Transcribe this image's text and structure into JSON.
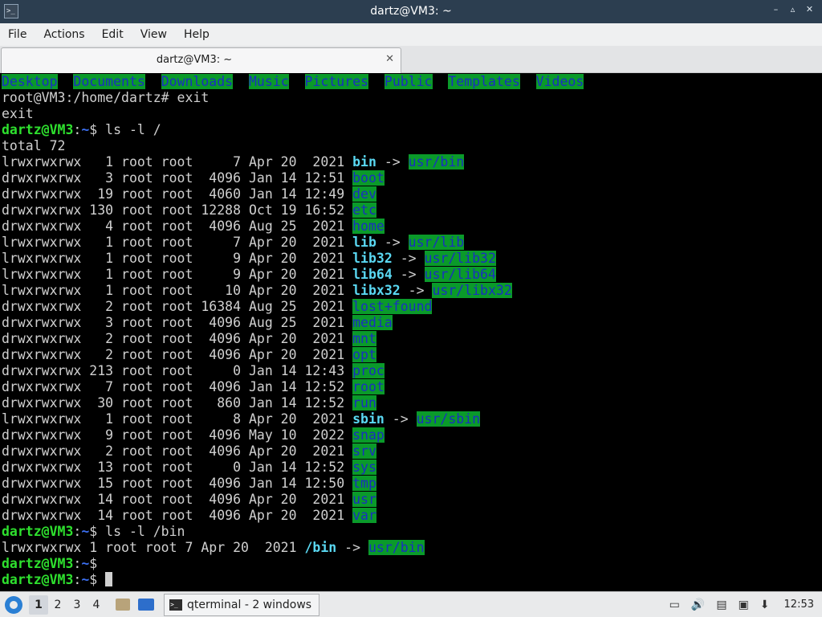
{
  "window": {
    "title": "dartz@VM3: ~",
    "controls": [
      "–",
      "▵",
      "✕"
    ]
  },
  "menubar": [
    "File",
    "Actions",
    "Edit",
    "View",
    "Help"
  ],
  "tab": {
    "label": "dartz@VM3: ~"
  },
  "terminal": {
    "home_dirs": [
      "Desktop",
      "Documents",
      "Downloads",
      "Music",
      "Pictures",
      "Public",
      "Templates",
      "Videos"
    ],
    "root_prompt": "root@VM3:/home/dartz#",
    "root_cmd": " exit",
    "exit_out": "exit",
    "prompt_user": "dartz@VM3",
    "prompt_path": "~",
    "cmd1": "$ ls -l /",
    "total": "total 72",
    "entries": [
      {
        "meta": "lrwxrwxrwx   1 root root     7 Apr 20  2021 ",
        "name": "bin",
        "link": true,
        "target": "usr/bin"
      },
      {
        "meta": "drwxrwxrwx   3 root root  4096 Jan 14 12:51 ",
        "name": "boot",
        "link": false
      },
      {
        "meta": "drwxrwxrwx  19 root root  4060 Jan 14 12:49 ",
        "name": "dev",
        "link": false
      },
      {
        "meta": "drwxrwxrwx 130 root root 12288 Oct 19 16:52 ",
        "name": "etc",
        "link": false
      },
      {
        "meta": "drwxrwxrwx   4 root root  4096 Aug 25  2021 ",
        "name": "home",
        "link": false
      },
      {
        "meta": "lrwxrwxrwx   1 root root     7 Apr 20  2021 ",
        "name": "lib",
        "link": true,
        "target": "usr/lib"
      },
      {
        "meta": "lrwxrwxrwx   1 root root     9 Apr 20  2021 ",
        "name": "lib32",
        "link": true,
        "target": "usr/lib32"
      },
      {
        "meta": "lrwxrwxrwx   1 root root     9 Apr 20  2021 ",
        "name": "lib64",
        "link": true,
        "target": "usr/lib64"
      },
      {
        "meta": "lrwxrwxrwx   1 root root    10 Apr 20  2021 ",
        "name": "libx32",
        "link": true,
        "target": "usr/libx32"
      },
      {
        "meta": "drwxrwxrwx   2 root root 16384 Aug 25  2021 ",
        "name": "lost+found",
        "link": false
      },
      {
        "meta": "drwxrwxrwx   3 root root  4096 Aug 25  2021 ",
        "name": "media",
        "link": false
      },
      {
        "meta": "drwxrwxrwx   2 root root  4096 Apr 20  2021 ",
        "name": "mnt",
        "link": false
      },
      {
        "meta": "drwxrwxrwx   2 root root  4096 Apr 20  2021 ",
        "name": "opt",
        "link": false
      },
      {
        "meta": "drwxrwxrwx 213 root root     0 Jan 14 12:43 ",
        "name": "proc",
        "link": false
      },
      {
        "meta": "drwxrwxrwx   7 root root  4096 Jan 14 12:52 ",
        "name": "root",
        "link": false
      },
      {
        "meta": "drwxrwxrwx  30 root root   860 Jan 14 12:52 ",
        "name": "run",
        "link": false
      },
      {
        "meta": "lrwxrwxrwx   1 root root     8 Apr 20  2021 ",
        "name": "sbin",
        "link": true,
        "target": "usr/sbin"
      },
      {
        "meta": "drwxrwxrwx   9 root root  4096 May 10  2022 ",
        "name": "snap",
        "link": false
      },
      {
        "meta": "drwxrwxrwx   2 root root  4096 Apr 20  2021 ",
        "name": "srv",
        "link": false
      },
      {
        "meta": "drwxrwxrwx  13 root root     0 Jan 14 12:52 ",
        "name": "sys",
        "link": false
      },
      {
        "meta": "drwxrwxrwx  15 root root  4096 Jan 14 12:50 ",
        "name": "tmp",
        "link": false
      },
      {
        "meta": "drwxrwxrwx  14 root root  4096 Apr 20  2021 ",
        "name": "usr",
        "link": false
      },
      {
        "meta": "drwxrwxrwx  14 root root  4096 Apr 20  2021 ",
        "name": "var",
        "link": false
      }
    ],
    "arrow": " -> ",
    "cmd2": "$ ls -l /bin",
    "bin_meta": "lrwxrwxrwx 1 root root 7 Apr 20  2021 ",
    "bin_name": "/bin",
    "bin_target": "usr/bin",
    "dollar": "$"
  },
  "taskbar": {
    "workspaces": [
      "1",
      "2",
      "3",
      "4"
    ],
    "task_label": "qterminal - 2 windows",
    "clock": "12:53",
    "tray_icons": [
      "monitor-icon",
      "volume-icon",
      "clipboard-icon",
      "network-icon",
      "update-icon"
    ]
  }
}
